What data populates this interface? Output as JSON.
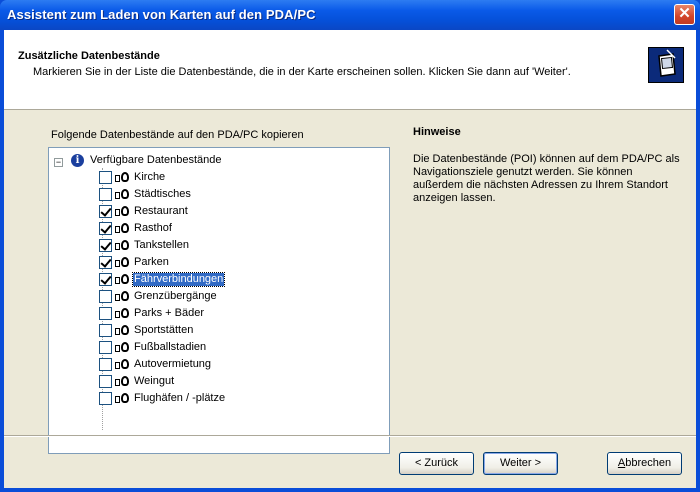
{
  "window": {
    "title": "Assistent zum Laden von Karten auf den PDA/PC",
    "close_glyph": "✕"
  },
  "header": {
    "title": "Zusätzliche Datenbestände",
    "subtitle": "Markieren Sie in der Liste die Datenbestände, die in der Karte erscheinen sollen. Klicken Sie dann auf 'Weiter'."
  },
  "left_label": "Folgende Datenbestände auf den PDA/PC kopieren",
  "tree": {
    "root_label": "Verfügbare Datenbestände",
    "expander_glyph": "−",
    "root_icon": "info-icon",
    "item_icon": "poi-camera-icon",
    "items": [
      {
        "label": "Kirche",
        "checked": false
      },
      {
        "label": "Städtisches",
        "checked": false
      },
      {
        "label": "Restaurant",
        "checked": true
      },
      {
        "label": "Rasthof",
        "checked": true
      },
      {
        "label": "Tankstellen",
        "checked": true
      },
      {
        "label": "Parken",
        "checked": true
      },
      {
        "label": "Fährverbindungen",
        "checked": true,
        "selected": true
      },
      {
        "label": "Grenzübergänge",
        "checked": false
      },
      {
        "label": "Parks + Bäder",
        "checked": false
      },
      {
        "label": "Sportstätten",
        "checked": false
      },
      {
        "label": "Fußballstadien",
        "checked": false
      },
      {
        "label": "Autovermietung",
        "checked": false
      },
      {
        "label": "Weingut",
        "checked": false
      },
      {
        "label": "Flughäfen / -plätze",
        "checked": false
      }
    ]
  },
  "hints": {
    "title": "Hinweise",
    "text": "Die Datenbestände (POI) können auf dem PDA/PC als Navigationsziele genutzt werden. Sie können außerdem die nächsten Adressen zu Ihrem Standort anzeigen lassen."
  },
  "buttons": {
    "back": "< Zurück",
    "next": "Weiter >",
    "cancel_prefix": "A",
    "cancel_rest": "bbrechen"
  },
  "colors": {
    "titlebar": "#0550d8",
    "selection": "#316ac5",
    "dialog_bg": "#ece9d8"
  }
}
